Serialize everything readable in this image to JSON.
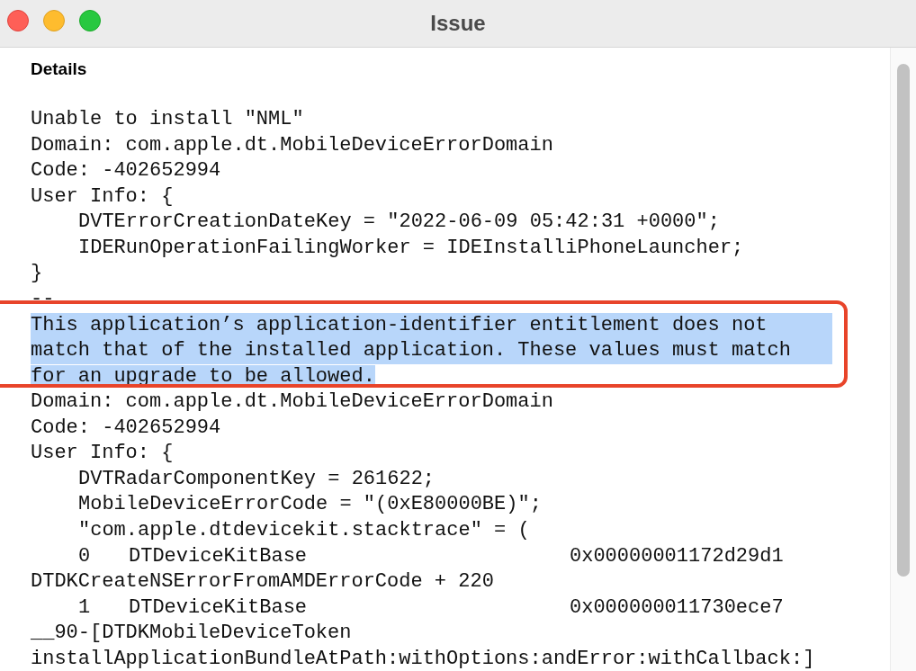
{
  "window": {
    "title": "Issue"
  },
  "details": {
    "heading": "Details",
    "lines": [
      {
        "kind": "plain",
        "text": "Unable to install \"NML\"",
        "selected": false
      },
      {
        "kind": "plain",
        "text": "Domain: com.apple.dt.MobileDeviceErrorDomain",
        "selected": false
      },
      {
        "kind": "plain",
        "text": "Code: -402652994",
        "selected": false
      },
      {
        "kind": "plain",
        "text": "User Info: {",
        "selected": false
      },
      {
        "kind": "indented",
        "text": "DVTErrorCreationDateKey = \"2022-06-09 05:42:31 +0000\";",
        "selected": false
      },
      {
        "kind": "indented",
        "text": "IDERunOperationFailingWorker = IDEInstalliPhoneLauncher;",
        "selected": false
      },
      {
        "kind": "plain",
        "text": "}",
        "selected": false
      },
      {
        "kind": "plain",
        "text": "--",
        "selected": false
      },
      {
        "kind": "plain",
        "text": "This application’s application-identifier entitlement does not",
        "selected": true
      },
      {
        "kind": "plain",
        "text": "match that of the installed application. These values must match",
        "selected": true
      },
      {
        "kind": "plain",
        "text": "for an upgrade to be allowed.",
        "selected": true
      },
      {
        "kind": "plain",
        "text": "Domain: com.apple.dt.MobileDeviceErrorDomain",
        "selected": false
      },
      {
        "kind": "plain",
        "text": "Code: -402652994",
        "selected": false
      },
      {
        "kind": "plain",
        "text": "User Info: {",
        "selected": false
      },
      {
        "kind": "indented",
        "text": "DVTRadarComponentKey = 261622;",
        "selected": false
      },
      {
        "kind": "indented",
        "text": "MobileDeviceErrorCode = \"(0xE80000BE)\";",
        "selected": false
      },
      {
        "kind": "indented",
        "text": "\"com.apple.dtdevicekit.stacktrace\" = (",
        "selected": false
      },
      {
        "kind": "frame",
        "index": "0",
        "symbol": "DTDeviceKitBase",
        "address": "0x00000001172d29d1",
        "selected": false
      },
      {
        "kind": "plain",
        "text": "DTDKCreateNSErrorFromAMDErrorCode + 220",
        "selected": false
      },
      {
        "kind": "frame",
        "index": "1",
        "symbol": "DTDeviceKitBase",
        "address": "0x000000011730ece7",
        "selected": false
      },
      {
        "kind": "plain",
        "text": "__90-[DTDKMobileDeviceToken",
        "selected": false
      },
      {
        "kind": "plain",
        "text": "installApplicationBundleAtPath:withOptions:andError:withCallback:]",
        "selected": false
      }
    ]
  }
}
